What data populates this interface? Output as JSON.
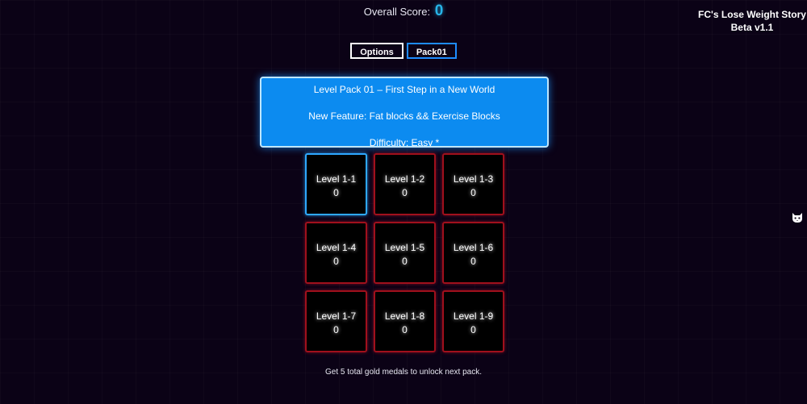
{
  "score": {
    "label": "Overall Score:",
    "value": "0"
  },
  "game": {
    "title_line1": "FC's Lose Weight Story",
    "title_line2": "Beta v1.1"
  },
  "tabs": {
    "options_label": "Options",
    "pack_label": "Pack01"
  },
  "pack": {
    "title": "Level Pack 01 – First Step in a New World",
    "feature": "New Feature: Fat blocks && Exercise Blocks",
    "difficulty": "Difficulty: Easy *"
  },
  "levels": [
    {
      "name": "Level 1-1",
      "score": "0",
      "state": "unlocked"
    },
    {
      "name": "Level 1-2",
      "score": "0",
      "state": "locked"
    },
    {
      "name": "Level 1-3",
      "score": "0",
      "state": "locked"
    },
    {
      "name": "Level 1-4",
      "score": "0",
      "state": "locked"
    },
    {
      "name": "Level 1-5",
      "score": "0",
      "state": "locked"
    },
    {
      "name": "Level 1-6",
      "score": "0",
      "state": "locked"
    },
    {
      "name": "Level 1-7",
      "score": "0",
      "state": "locked"
    },
    {
      "name": "Level 1-8",
      "score": "0",
      "state": "locked"
    },
    {
      "name": "Level 1-9",
      "score": "0",
      "state": "locked"
    }
  ],
  "hint": "Get 5 total gold medals to unlock next pack.",
  "colors": {
    "background": "#0b0216",
    "score_accent": "#27b4e8",
    "pack_panel": "#0c8bf0",
    "unlocked_border": "#2ea8ff",
    "locked_border": "#a0101c"
  },
  "icons": {
    "corner": "cat-mascot-icon"
  }
}
